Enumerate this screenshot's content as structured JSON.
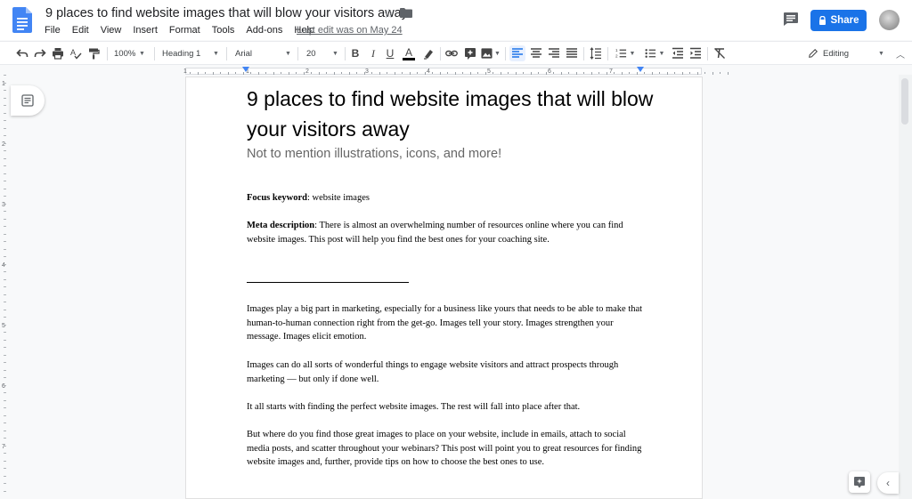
{
  "app": {
    "title": "9 places to find website images that will blow your visitors away",
    "menu": [
      "File",
      "Edit",
      "View",
      "Insert",
      "Format",
      "Tools",
      "Add-ons",
      "Help"
    ],
    "last_edit": "Last edit was on May 24",
    "share_label": "Share",
    "accent": "#1a73e8"
  },
  "toolbar": {
    "zoom": "100%",
    "style": "Heading 1",
    "font": "Arial",
    "font_size": "20",
    "mode": "Editing"
  },
  "ruler": {
    "numbers": [
      "1",
      "1",
      "2",
      "3",
      "4",
      "5",
      "6",
      "7"
    ],
    "vnumbers": [
      "1",
      "2",
      "3",
      "4",
      "5",
      "6",
      "7"
    ]
  },
  "document": {
    "heading": "9 places to find website images that will blow your visitors away",
    "subtitle": "Not to mention illustrations, icons, and more!",
    "focus_label": "Focus keyword",
    "focus_value": ": website images",
    "meta_label": "Meta description",
    "meta_value": ": There is almost an overwhelming number of resources online where you can find website images. This post will help you find the best ones for your coaching site.",
    "p1": "Images play a big part in marketing, especially for a business like yours that needs to be able to make that human-to-human connection right from the get-go. Images tell your story. Images strengthen your message. Images elicit emotion.",
    "p2": "Images can do all sorts of wonderful things to engage website visitors and attract prospects through marketing — but only if done well.",
    "p3": "It all starts with finding the perfect website images. The rest will fall into place after that.",
    "p4": "But where do you find those great images to place on your website, include in emails, attach to social media posts, and scatter throughout your webinars? This post will point you to great resources for finding website images and, further, provide tips on how to choose the best ones to use."
  }
}
